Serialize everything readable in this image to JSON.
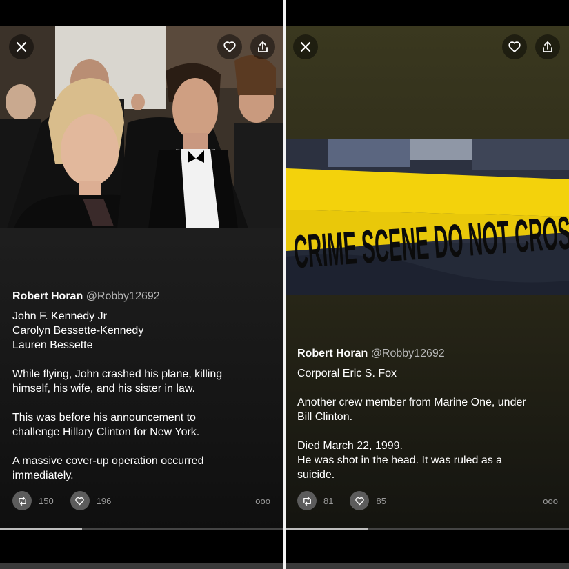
{
  "left": {
    "author": {
      "name": "Robert Horan",
      "handle": "@Robby12692"
    },
    "paragraphs": [
      [
        "John F. Kennedy Jr",
        "Carolyn Bessette-Kennedy",
        "Lauren Bessette"
      ],
      [
        "While flying, John crashed his plane, killing",
        "himself, his wife, and his sister in law."
      ],
      [
        "This was before his announcement to",
        "challenge Hillary Clinton for New York."
      ],
      [
        "A massive cover-up operation occurred",
        "immediately."
      ]
    ],
    "retweets": "150",
    "likes": "196",
    "more": "ooo",
    "progress": 0.29
  },
  "right": {
    "author": {
      "name": "Robert Horan",
      "handle": "@Robby12692"
    },
    "tape_text": "CRIME SCENE DO NOT CROSS",
    "paragraphs": [
      [
        "Corporal Eric S. Fox"
      ],
      [
        "Another crew member from Marine One, under",
        "Bill Clinton."
      ],
      [
        "Died March 22, 1999.",
        "He was shot in the head. It was ruled as a",
        "suicide."
      ]
    ],
    "retweets": "81",
    "likes": "85",
    "more": "ooo",
    "progress": 0.29
  },
  "icons": {
    "close": "close-icon",
    "heart": "heart-icon",
    "share": "share-icon",
    "retweet": "retweet-icon",
    "like": "heart-icon",
    "more": "more-icon"
  },
  "colors": {
    "tape": "#f3d20c",
    "left_bg": "#1d1d1d",
    "right_bg": "#2d2b19"
  }
}
